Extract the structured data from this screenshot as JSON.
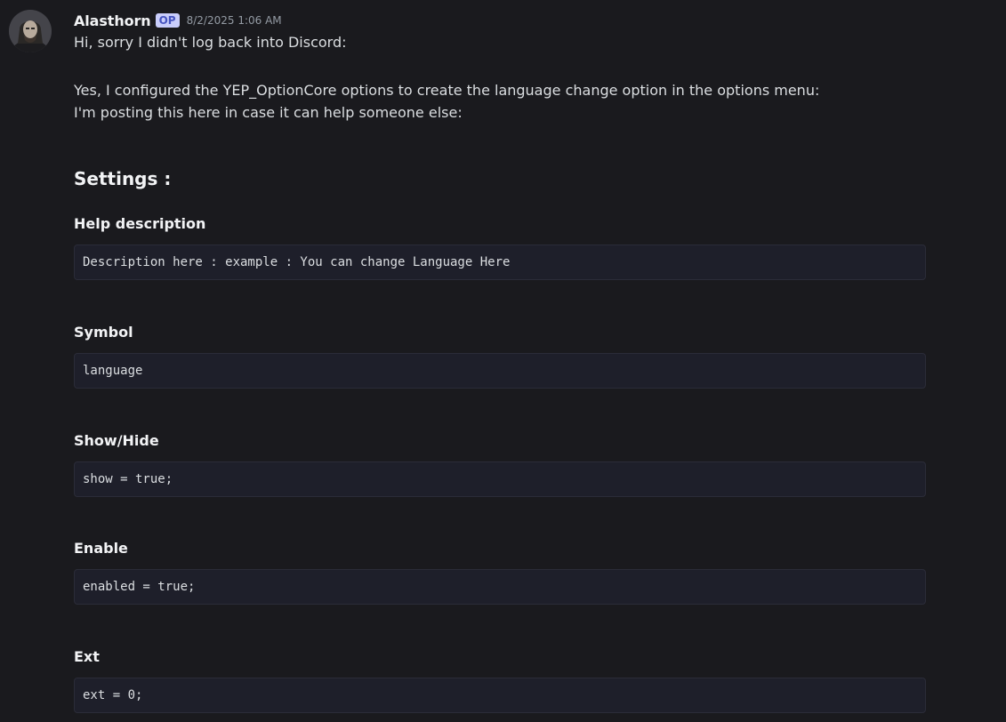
{
  "message": {
    "author": "Alasthorn",
    "badge": "OP",
    "timestamp": "8/2/2025 1:06 AM",
    "lines": [
      "Hi, sorry I didn't log back into Discord:",
      "Yes, I configured the YEP_OptionCore options to create the language change option in the options menu:",
      "I'm posting this here in case it can help someone else:"
    ],
    "heading": "Settings :",
    "sections": [
      {
        "title": "Help description",
        "code": "Description here : example : You can change Language Here"
      },
      {
        "title": "Symbol",
        "code": "language"
      },
      {
        "title": "Show/Hide",
        "code": "show = true;"
      },
      {
        "title": "Enable",
        "code": "enabled = true;"
      },
      {
        "title": "Ext",
        "code": "ext = 0;"
      }
    ]
  },
  "colors": {
    "background": "#1a1a1e",
    "codeblock": "#1e1f2a",
    "op_badge_bg": "#c9cdfb",
    "op_badge_text": "#4654c0"
  },
  "icons": {
    "avatar": "user-avatar-portrait"
  }
}
